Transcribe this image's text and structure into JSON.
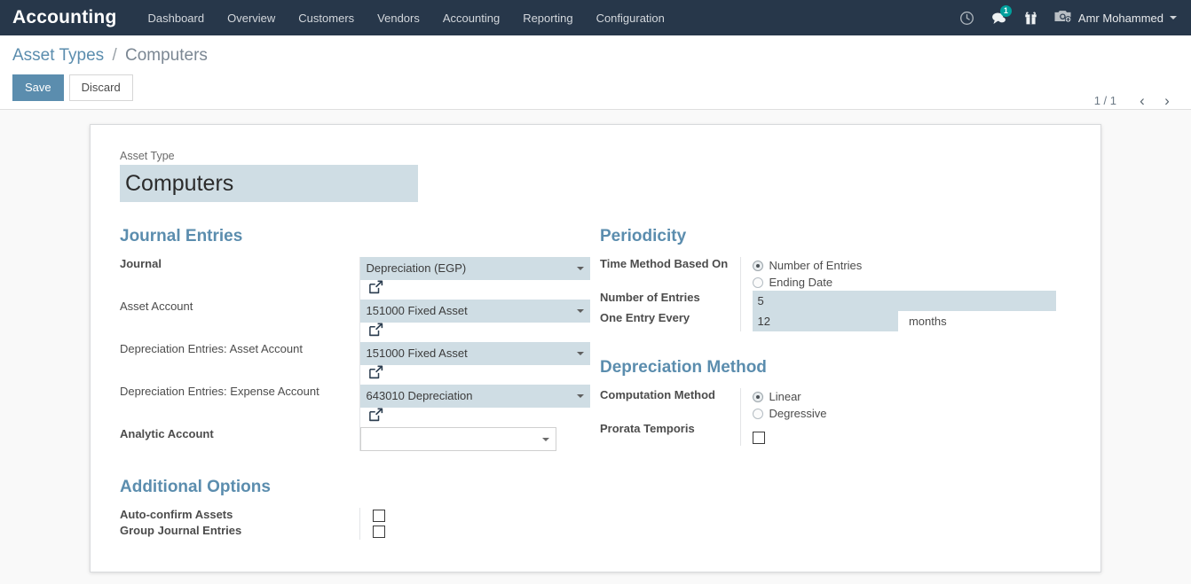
{
  "navbar": {
    "brand": "Accounting",
    "menu": [
      {
        "label": "Dashboard"
      },
      {
        "label": "Overview"
      },
      {
        "label": "Customers"
      },
      {
        "label": "Vendors"
      },
      {
        "label": "Accounting"
      },
      {
        "label": "Reporting"
      },
      {
        "label": "Configuration"
      }
    ],
    "icons": {
      "activity": "clock-icon",
      "messages": "chat-icon",
      "messages_count": "1",
      "gift": "gift-icon",
      "avatar": "camera-avatar-icon"
    },
    "user": "Amr Mohammed",
    "brand_bg": "#27374a",
    "badge_color": "#00a09d"
  },
  "control_panel": {
    "breadcrumb_root": "Asset Types",
    "breadcrumb_sep": "/",
    "breadcrumb_current": "Computers",
    "save_label": "Save",
    "discard_label": "Discard",
    "pager_value": "1 / 1",
    "pager_prev": "‹",
    "pager_next": "›",
    "accent_color": "#5b8dae"
  },
  "form": {
    "asset_type_label": "Asset Type",
    "asset_type_value": "Computers",
    "journal_entries": {
      "title": "Journal Entries",
      "rows": [
        {
          "label": "Journal",
          "required": true,
          "value": "Depreciation (EGP)",
          "kind": "select",
          "ext_link": true
        },
        {
          "label": "Asset Account",
          "required": false,
          "value": "151000 Fixed Asset",
          "kind": "select",
          "ext_link": true
        },
        {
          "label": "Depreciation Entries: Asset Account",
          "required": false,
          "value": "151000 Fixed Asset",
          "kind": "select",
          "ext_link": true
        },
        {
          "label": "Depreciation Entries: Expense Account",
          "required": false,
          "value": "643010 Depreciation",
          "kind": "select",
          "ext_link": true
        },
        {
          "label": "Analytic Account",
          "required": true,
          "value": "",
          "kind": "select-empty",
          "ext_link": false
        }
      ]
    },
    "periodicity": {
      "title": "Periodicity",
      "time_method_label": "Time Method Based On",
      "time_method_options": [
        {
          "label": "Number of Entries",
          "selected": true
        },
        {
          "label": "Ending Date",
          "selected": false
        }
      ],
      "number_of_entries_label": "Number of Entries",
      "number_of_entries_value": "5",
      "one_entry_every_label": "One Entry Every",
      "one_entry_every_value": "12",
      "one_entry_every_unit": "months"
    },
    "additional_options": {
      "title": "Additional Options",
      "rows": [
        {
          "label": "Auto-confirm Assets",
          "checked": false
        },
        {
          "label": "Group Journal Entries",
          "checked": false
        }
      ]
    },
    "depreciation_method": {
      "title": "Depreciation Method",
      "computation_label": "Computation Method",
      "computation_options": [
        {
          "label": "Linear",
          "selected": true
        },
        {
          "label": "Degressive",
          "selected": false
        }
      ],
      "prorata_label": "Prorata Temporis",
      "prorata_checked": false
    },
    "field_bg": "#cfdde4",
    "group_title_color": "#5b8dae"
  }
}
